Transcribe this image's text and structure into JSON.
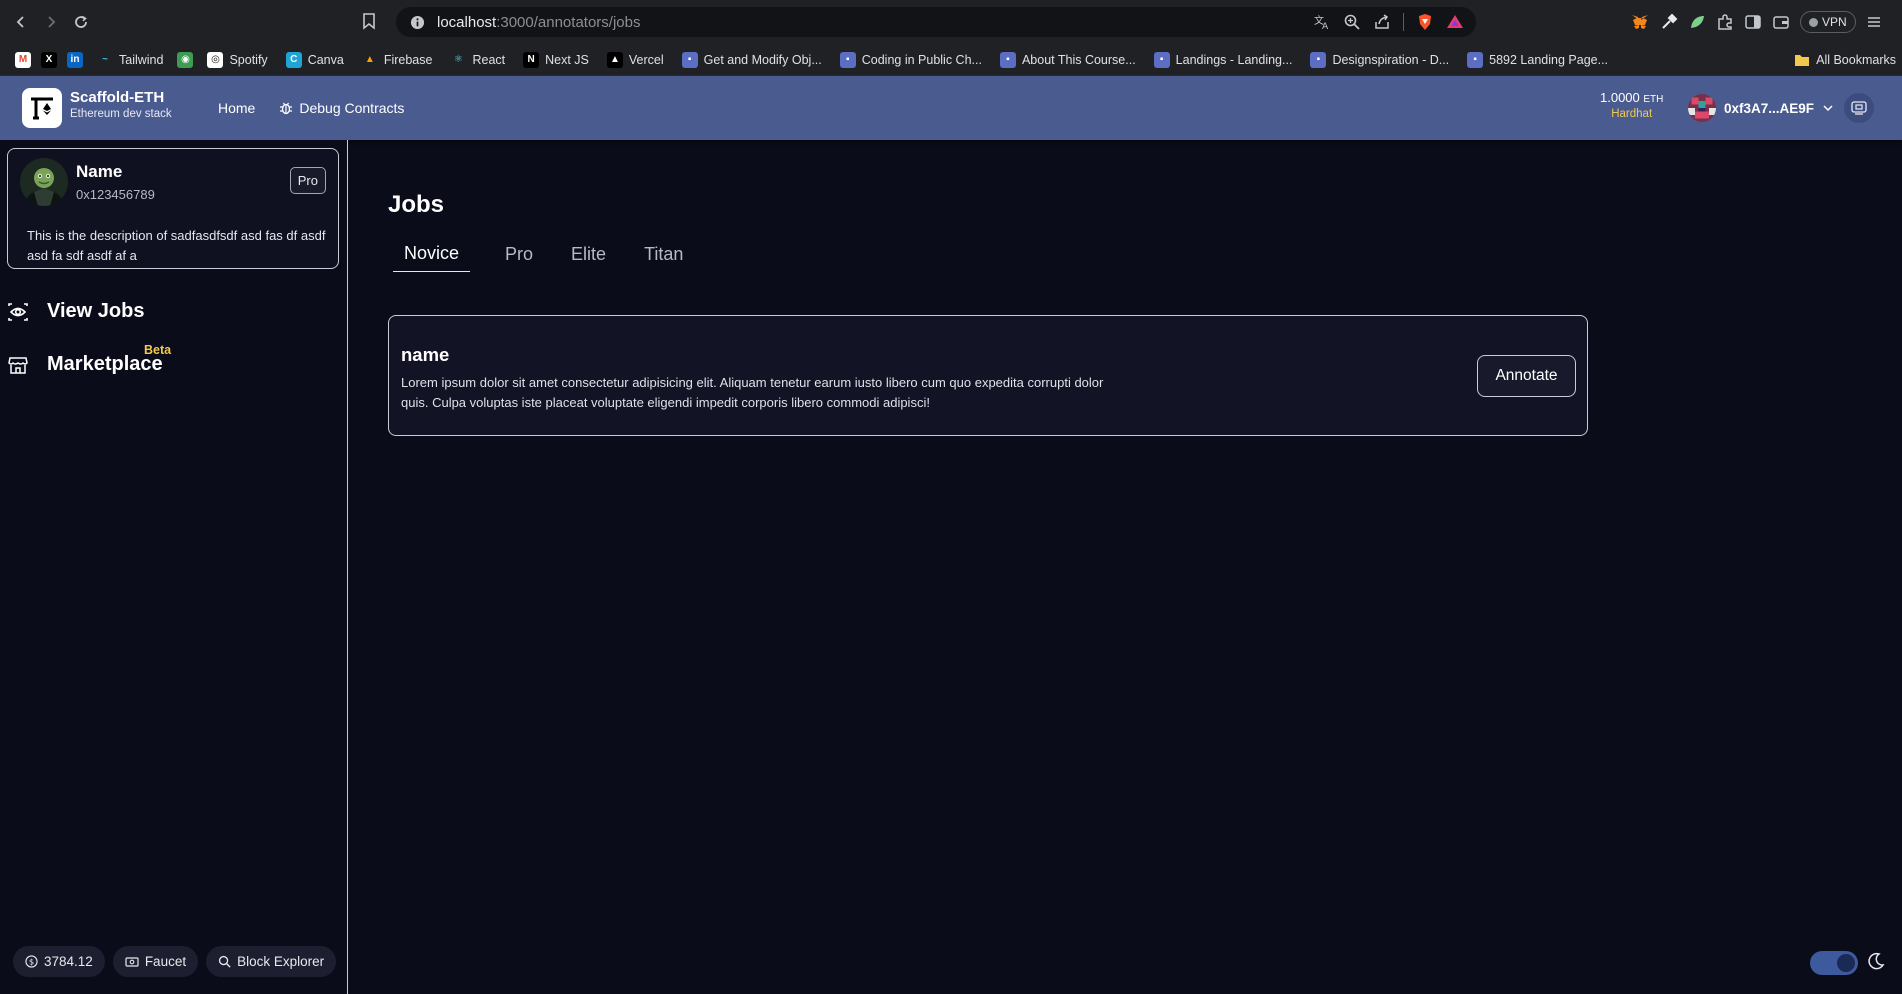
{
  "browser": {
    "url_host": "localhost",
    "url_path": ":3000/annotators/jobs",
    "vpn_label": "VPN",
    "bookmarks": [
      {
        "label": "",
        "icon": "gmail-icon"
      },
      {
        "label": "",
        "icon": "x-icon"
      },
      {
        "label": "",
        "icon": "linkedin-icon"
      },
      {
        "label": "Tailwind",
        "icon": "tailwind-icon"
      },
      {
        "label": "",
        "icon": "extension-icon"
      },
      {
        "label": "Spotify",
        "icon": "spotify-icon"
      },
      {
        "label": "Canva",
        "icon": "canva-icon"
      },
      {
        "label": "Firebase",
        "icon": "firebase-icon"
      },
      {
        "label": "React",
        "icon": "react-icon"
      },
      {
        "label": "Next JS",
        "icon": "nextjs-icon"
      },
      {
        "label": "Vercel",
        "icon": "vercel-icon"
      },
      {
        "label": "Get and Modify Obj...",
        "icon": "page-icon"
      },
      {
        "label": "Coding in Public Ch...",
        "icon": "page-icon"
      },
      {
        "label": "About This Course...",
        "icon": "page-icon"
      },
      {
        "label": "Landings - Landing...",
        "icon": "page-icon"
      },
      {
        "label": "Designspiration - D...",
        "icon": "page-icon"
      },
      {
        "label": "5892 Landing Page...",
        "icon": "page-icon"
      }
    ],
    "all_bookmarks": "All Bookmarks"
  },
  "header": {
    "brand_name": "Scaffold-ETH",
    "brand_sub": "Ethereum dev stack",
    "nav": [
      {
        "label": "Home"
      },
      {
        "label": "Debug Contracts"
      }
    ],
    "balance": "1.0000",
    "balance_unit": "ETH",
    "network": "Hardhat",
    "address": "0xf3A7...AE9F"
  },
  "profile": {
    "name": "Name",
    "address": "0x123456789",
    "badge": "Pro",
    "description": "This is the description of sadfasdfsdf asd fas df asdf asd fa sdf asdf af a"
  },
  "sidebar": {
    "links": [
      {
        "label": "View Jobs"
      },
      {
        "label": "Marketplace"
      }
    ],
    "beta": "Beta",
    "footer": {
      "price": "3784.12",
      "faucet": "Faucet",
      "explorer": "Block Explorer"
    }
  },
  "main": {
    "title": "Jobs",
    "tabs": [
      {
        "label": "Novice",
        "active": true
      },
      {
        "label": "Pro",
        "active": false
      },
      {
        "label": "Elite",
        "active": false
      },
      {
        "label": "Titan",
        "active": false
      }
    ],
    "jobs": [
      {
        "name": "name",
        "description": "Lorem ipsum dolor sit amet consectetur adipisicing elit. Aliquam tenetur earum iusto libero cum quo expedita corrupti dolor quis. Culpa voluptas iste placeat voluptate eligendi impedit corporis libero commodi adipisci!",
        "action": "Annotate"
      }
    ]
  },
  "colors": {
    "header_bg": "#4a5b90",
    "page_bg": "#0b0c1a",
    "accent_yellow": "#f2c94c"
  }
}
